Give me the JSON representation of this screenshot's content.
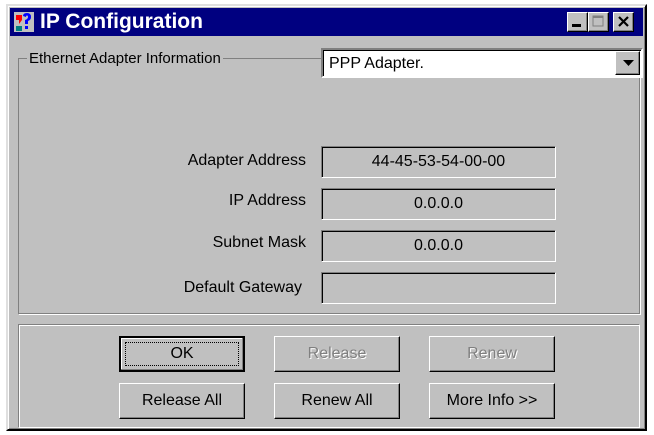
{
  "window": {
    "title": "IP Configuration",
    "caption_buttons": [
      "minimize",
      "maximize",
      "close"
    ],
    "title_bar_color": "#000080",
    "face_color": "#c0c0c0"
  },
  "adapter_group": {
    "legend": "Ethernet  Adapter Information",
    "adapter_select": {
      "selected": "PPP Adapter."
    },
    "fields": [
      {
        "label": "Adapter Address",
        "value": "44-45-53-54-00-00"
      },
      {
        "label": "IP Address",
        "value": "0.0.0.0"
      },
      {
        "label": "Subnet Mask",
        "value": "0.0.0.0"
      },
      {
        "label": "Default Gateway",
        "value": ""
      }
    ]
  },
  "buttons": {
    "ok": {
      "label": "OK",
      "enabled": true,
      "default": true
    },
    "release": {
      "label": "Release",
      "enabled": false
    },
    "renew": {
      "label": "Renew",
      "enabled": false
    },
    "release_all": {
      "label": "Release All",
      "enabled": true
    },
    "renew_all": {
      "label": "Renew All",
      "enabled": true
    },
    "more_info": {
      "label": "More Info >>",
      "enabled": true
    }
  },
  "icons": {
    "app": "network-help-icon",
    "minimize": "minimize-icon",
    "maximize": "maximize-icon",
    "close": "close-icon",
    "dropdown": "chevron-down-icon"
  }
}
